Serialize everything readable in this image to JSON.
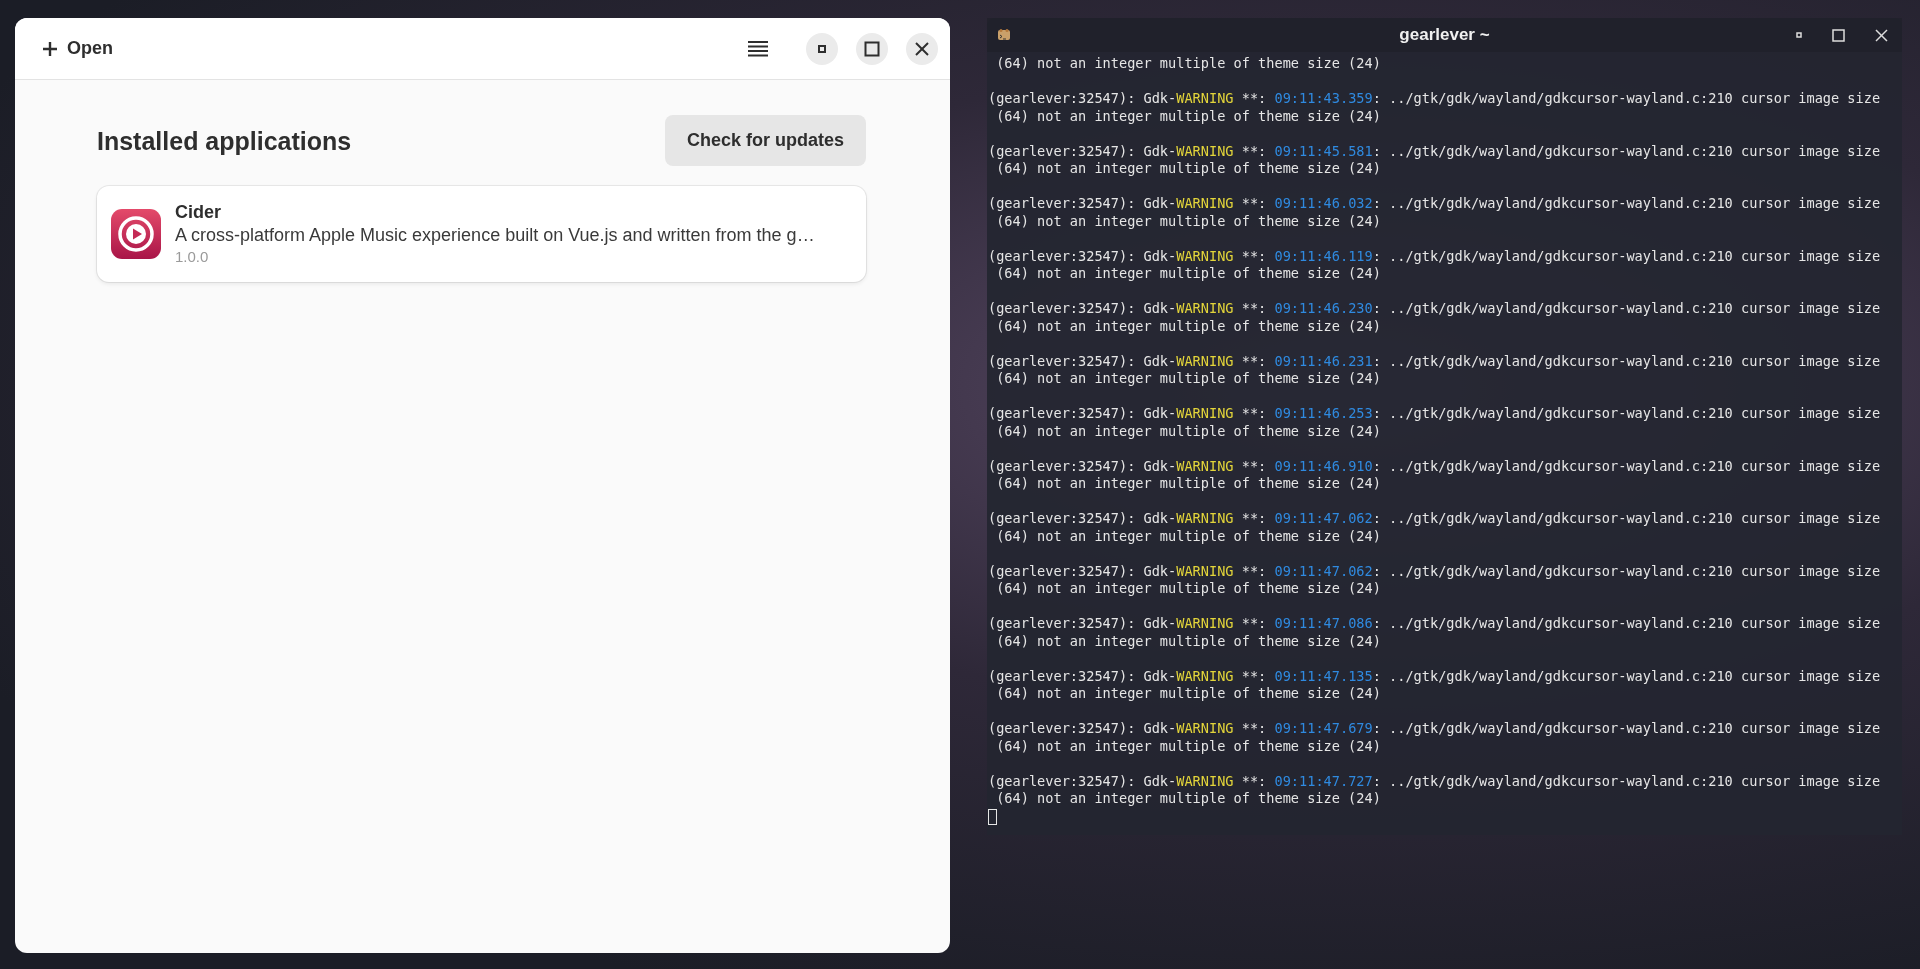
{
  "app_window": {
    "open_button": "Open",
    "heading": "Installed applications",
    "check_button": "Check for updates",
    "apps": [
      {
        "name": "Cider",
        "description": "A cross-platform Apple Music experience built on Vue.js and written from the g…",
        "version": "1.0.0"
      }
    ]
  },
  "terminal_window": {
    "title": "gearlever ~",
    "lines": [
      {
        "kind": "text",
        "text": " (64) not an integer multiple of theme size (24)"
      },
      {
        "kind": "warning",
        "source": "(gearlever:32547): Gdk-",
        "level": "WARNING",
        "marker": " **: ",
        "time": "09:11:43.359",
        "message": ": ../gtk/gdk/wayland/gdkcursor-wayland.c:210 cursor image size"
      },
      {
        "kind": "text",
        "text": " (64) not an integer multiple of theme size (24)"
      },
      {
        "kind": "warning",
        "source": "(gearlever:32547): Gdk-",
        "level": "WARNING",
        "marker": " **: ",
        "time": "09:11:45.581",
        "message": ": ../gtk/gdk/wayland/gdkcursor-wayland.c:210 cursor image size"
      },
      {
        "kind": "text",
        "text": " (64) not an integer multiple of theme size (24)"
      },
      {
        "kind": "warning",
        "source": "(gearlever:32547): Gdk-",
        "level": "WARNING",
        "marker": " **: ",
        "time": "09:11:46.032",
        "message": ": ../gtk/gdk/wayland/gdkcursor-wayland.c:210 cursor image size"
      },
      {
        "kind": "text",
        "text": " (64) not an integer multiple of theme size (24)"
      },
      {
        "kind": "warning",
        "source": "(gearlever:32547): Gdk-",
        "level": "WARNING",
        "marker": " **: ",
        "time": "09:11:46.119",
        "message": ": ../gtk/gdk/wayland/gdkcursor-wayland.c:210 cursor image size"
      },
      {
        "kind": "text",
        "text": " (64) not an integer multiple of theme size (24)"
      },
      {
        "kind": "warning",
        "source": "(gearlever:32547): Gdk-",
        "level": "WARNING",
        "marker": " **: ",
        "time": "09:11:46.230",
        "message": ": ../gtk/gdk/wayland/gdkcursor-wayland.c:210 cursor image size"
      },
      {
        "kind": "text",
        "text": " (64) not an integer multiple of theme size (24)"
      },
      {
        "kind": "warning",
        "source": "(gearlever:32547): Gdk-",
        "level": "WARNING",
        "marker": " **: ",
        "time": "09:11:46.231",
        "message": ": ../gtk/gdk/wayland/gdkcursor-wayland.c:210 cursor image size"
      },
      {
        "kind": "text",
        "text": " (64) not an integer multiple of theme size (24)"
      },
      {
        "kind": "warning",
        "source": "(gearlever:32547): Gdk-",
        "level": "WARNING",
        "marker": " **: ",
        "time": "09:11:46.253",
        "message": ": ../gtk/gdk/wayland/gdkcursor-wayland.c:210 cursor image size"
      },
      {
        "kind": "text",
        "text": " (64) not an integer multiple of theme size (24)"
      },
      {
        "kind": "warning",
        "source": "(gearlever:32547): Gdk-",
        "level": "WARNING",
        "marker": " **: ",
        "time": "09:11:46.910",
        "message": ": ../gtk/gdk/wayland/gdkcursor-wayland.c:210 cursor image size"
      },
      {
        "kind": "text",
        "text": " (64) not an integer multiple of theme size (24)"
      },
      {
        "kind": "warning",
        "source": "(gearlever:32547): Gdk-",
        "level": "WARNING",
        "marker": " **: ",
        "time": "09:11:47.062",
        "message": ": ../gtk/gdk/wayland/gdkcursor-wayland.c:210 cursor image size"
      },
      {
        "kind": "text",
        "text": " (64) not an integer multiple of theme size (24)"
      },
      {
        "kind": "warning",
        "source": "(gearlever:32547): Gdk-",
        "level": "WARNING",
        "marker": " **: ",
        "time": "09:11:47.062",
        "message": ": ../gtk/gdk/wayland/gdkcursor-wayland.c:210 cursor image size"
      },
      {
        "kind": "text",
        "text": " (64) not an integer multiple of theme size (24)"
      },
      {
        "kind": "warning",
        "source": "(gearlever:32547): Gdk-",
        "level": "WARNING",
        "marker": " **: ",
        "time": "09:11:47.086",
        "message": ": ../gtk/gdk/wayland/gdkcursor-wayland.c:210 cursor image size"
      },
      {
        "kind": "text",
        "text": " (64) not an integer multiple of theme size (24)"
      },
      {
        "kind": "warning",
        "source": "(gearlever:32547): Gdk-",
        "level": "WARNING",
        "marker": " **: ",
        "time": "09:11:47.135",
        "message": ": ../gtk/gdk/wayland/gdkcursor-wayland.c:210 cursor image size"
      },
      {
        "kind": "text",
        "text": " (64) not an integer multiple of theme size (24)"
      },
      {
        "kind": "warning",
        "source": "(gearlever:32547): Gdk-",
        "level": "WARNING",
        "marker": " **: ",
        "time": "09:11:47.679",
        "message": ": ../gtk/gdk/wayland/gdkcursor-wayland.c:210 cursor image size"
      },
      {
        "kind": "text",
        "text": " (64) not an integer multiple of theme size (24)"
      },
      {
        "kind": "warning",
        "source": "(gearlever:32547): Gdk-",
        "level": "WARNING",
        "marker": " **: ",
        "time": "09:11:47.727",
        "message": ": ../gtk/gdk/wayland/gdkcursor-wayland.c:210 cursor image size"
      },
      {
        "kind": "text",
        "text": " (64) not an integer multiple of theme size (24)"
      }
    ]
  }
}
